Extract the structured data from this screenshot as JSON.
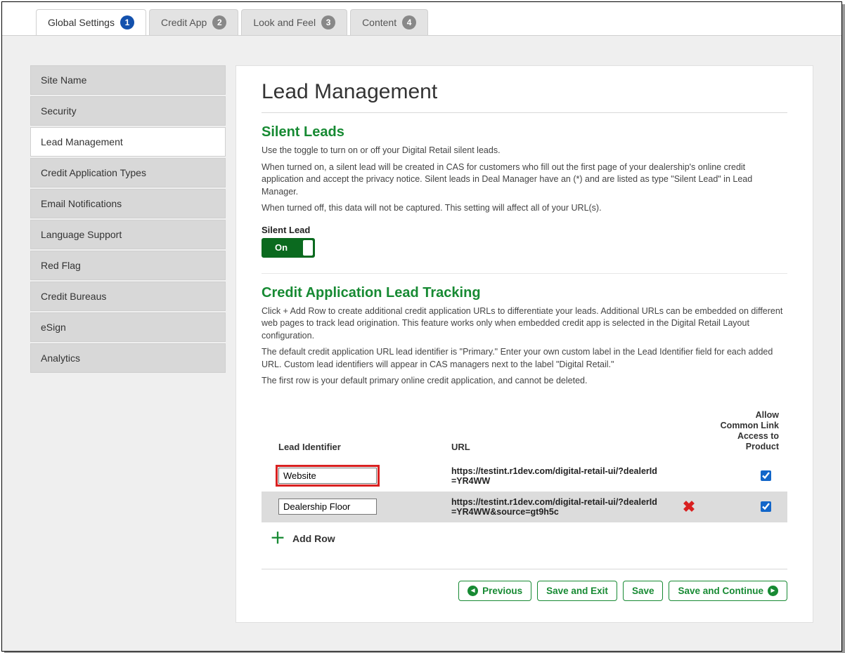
{
  "tabs": [
    {
      "label": "Global Settings",
      "num": "1",
      "active": true
    },
    {
      "label": "Credit App",
      "num": "2",
      "active": false
    },
    {
      "label": "Look and Feel",
      "num": "3",
      "active": false
    },
    {
      "label": "Content",
      "num": "4",
      "active": false
    }
  ],
  "sidebar": {
    "items": [
      {
        "label": "Site Name",
        "active": false
      },
      {
        "label": "Security",
        "active": false
      },
      {
        "label": "Lead Management",
        "active": true
      },
      {
        "label": "Credit Application Types",
        "active": false
      },
      {
        "label": "Email Notifications",
        "active": false
      },
      {
        "label": "Language Support",
        "active": false
      },
      {
        "label": "Red Flag",
        "active": false
      },
      {
        "label": "Credit Bureaus",
        "active": false
      },
      {
        "label": "eSign",
        "active": false
      },
      {
        "label": "Analytics",
        "active": false
      }
    ]
  },
  "page": {
    "title": "Lead Management",
    "silent": {
      "heading": "Silent Leads",
      "p1": "Use the toggle to turn on or off your Digital Retail silent leads.",
      "p2": "When turned on, a silent lead will be created in CAS for customers who fill out the first page of your dealership's online credit application and accept the privacy notice. Silent leads in Deal Manager have an (*) and are listed as type \"Silent Lead\" in Lead Manager.",
      "p3": "When turned off, this data will not be captured. This setting will affect all of your URL(s).",
      "toggle_label": "Silent Lead",
      "toggle_value": "On"
    },
    "tracking": {
      "heading": "Credit Application Lead Tracking",
      "p1": "Click + Add Row to create additional credit application URLs to differentiate your leads. Additional URLs can be embedded on different web pages to track lead origination. This feature works only when embedded credit app is selected in the Digital Retail Layout configuration.",
      "p2": "The default credit application URL lead identifier is \"Primary.\" Enter your own custom label in the Lead Identifier field for each added URL. Custom lead identifiers will appear in CAS managers next to the label \"Digital Retail.\"",
      "p3": "The first row is your default primary online credit application, and cannot be deleted."
    },
    "table": {
      "col_lead": "Lead Identifier",
      "col_url": "URL",
      "col_allow": "Allow Common Link Access to Product",
      "rows": [
        {
          "lead": "Website",
          "url": "https://testint.r1dev.com/digital-retail-ui/?dealerId=YR4WW",
          "deletable": false,
          "allow": true,
          "highlight": true
        },
        {
          "lead": "Dealership Floor",
          "url": "https://testint.r1dev.com/digital-retail-ui/?dealerId=YR4WW&source=gt9h5c",
          "deletable": true,
          "allow": true,
          "highlight": false
        }
      ],
      "add_label": "Add Row"
    },
    "buttons": {
      "previous": "Previous",
      "save_exit": "Save and Exit",
      "save": "Save",
      "save_continue": "Save and Continue"
    }
  }
}
